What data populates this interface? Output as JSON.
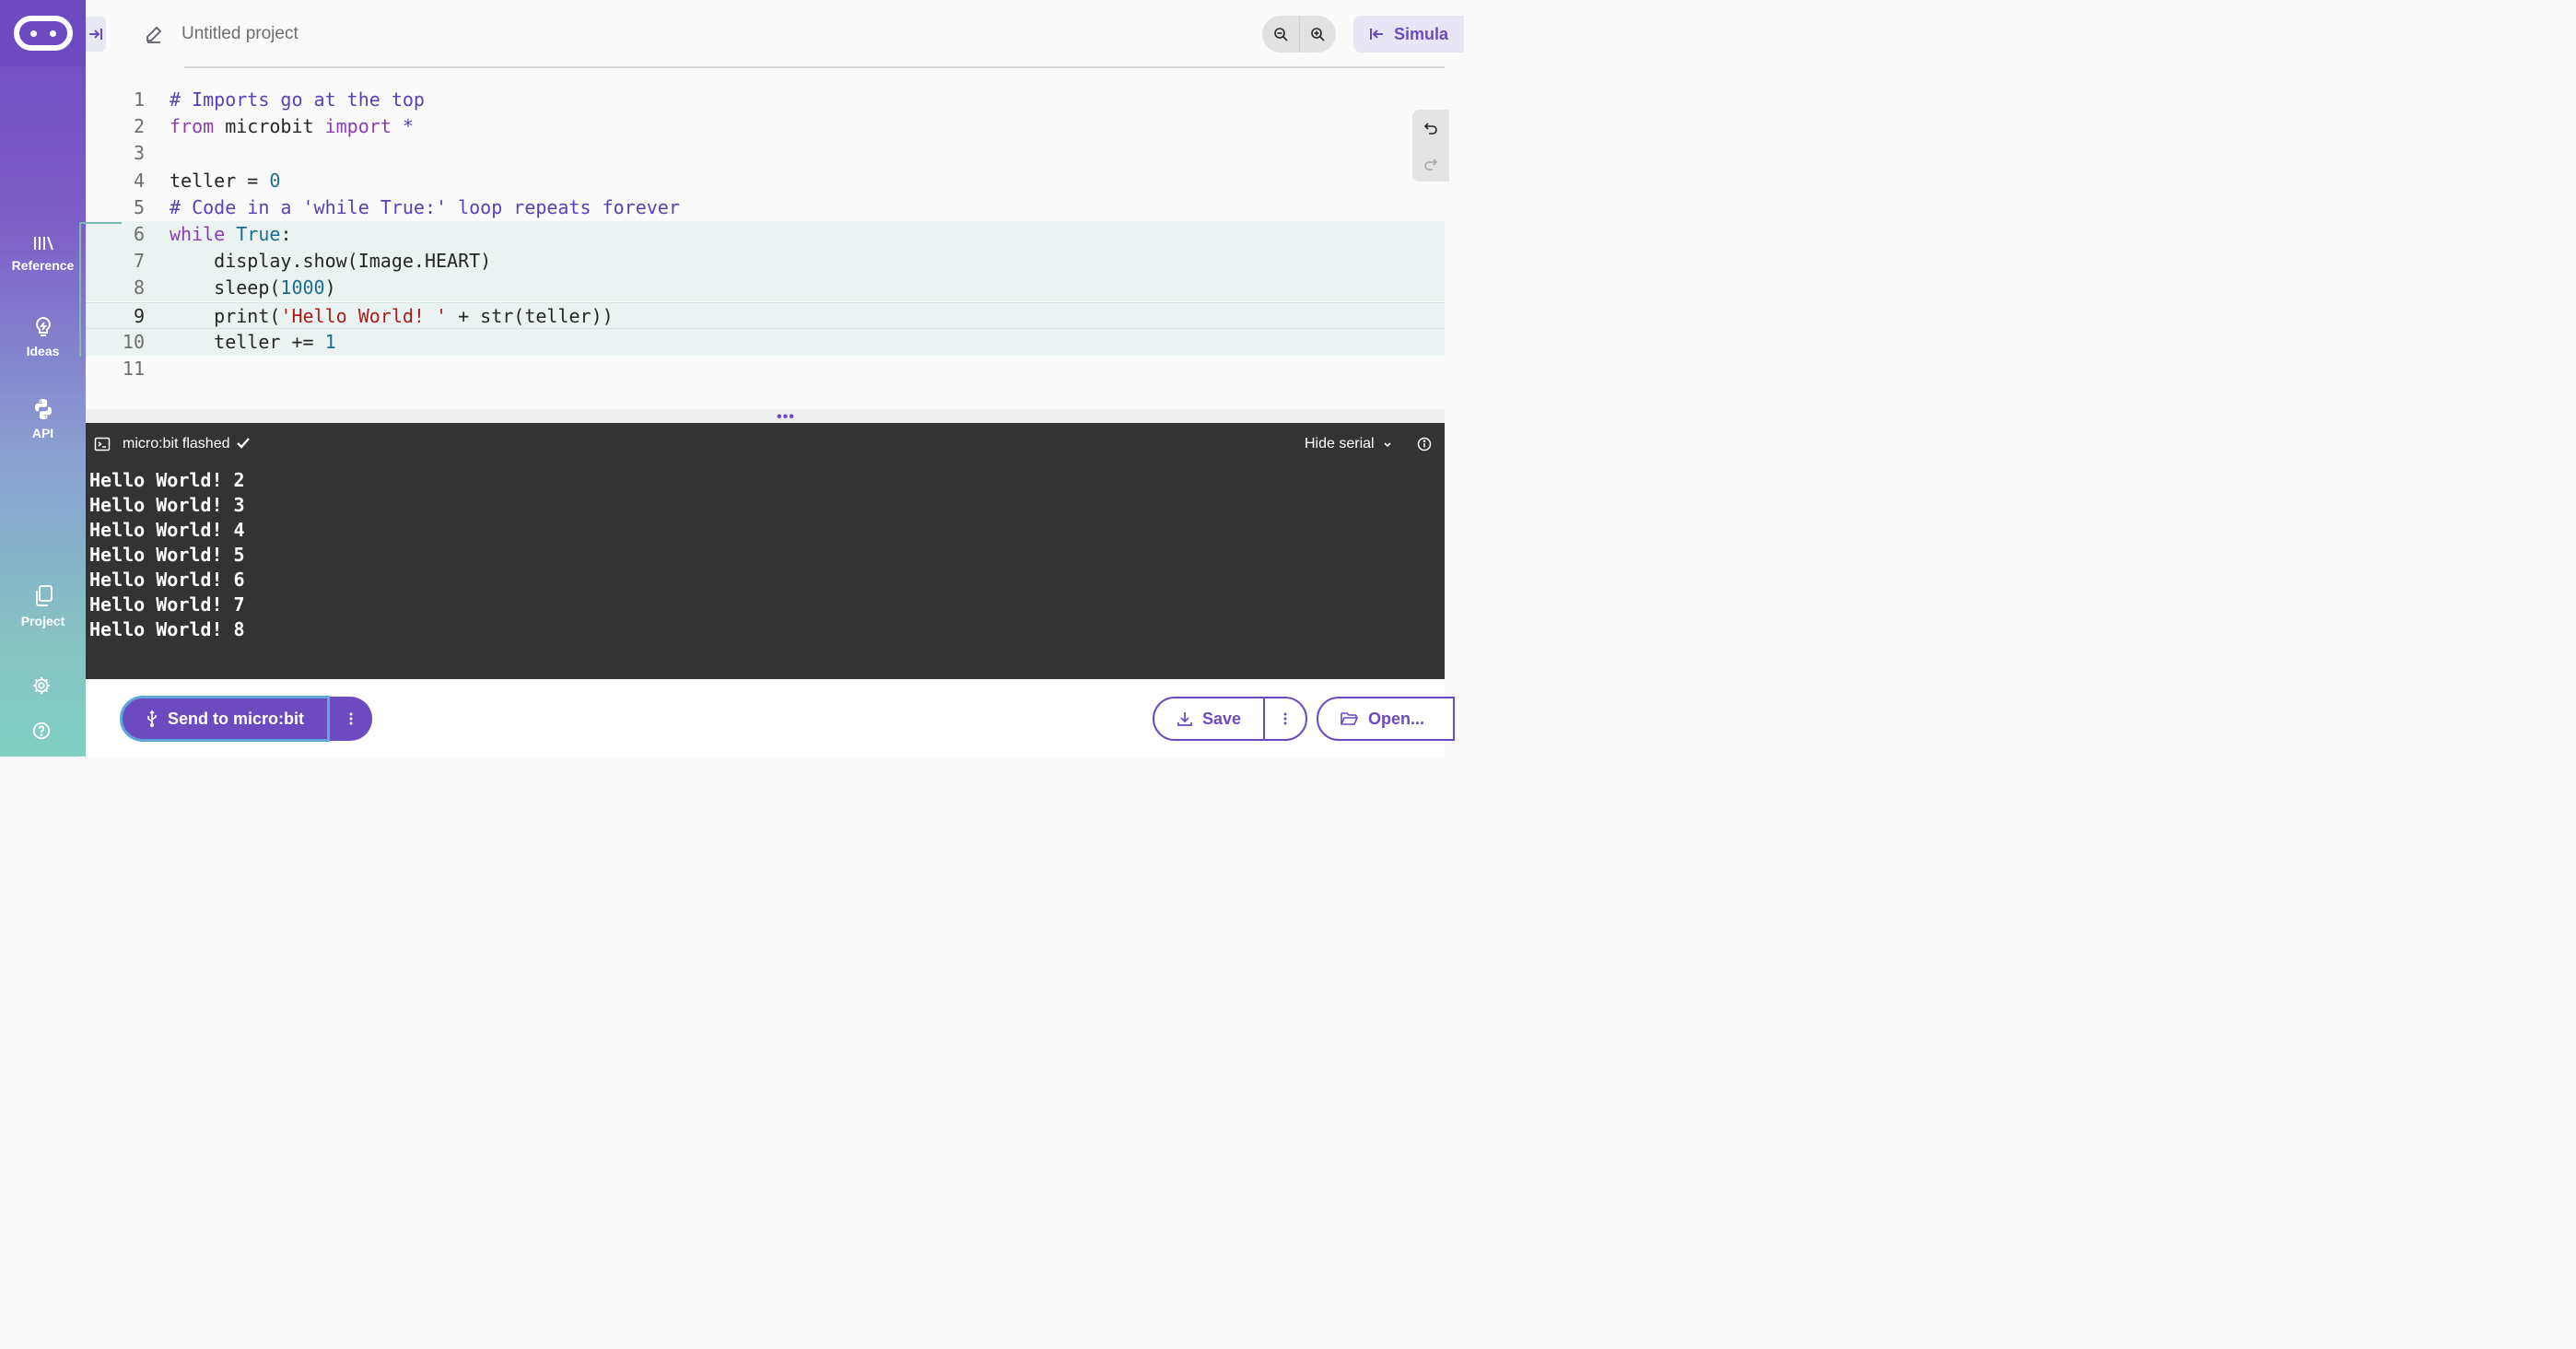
{
  "project": {
    "name": "Untitled project"
  },
  "sidebar": {
    "items": [
      {
        "label": "Reference",
        "icon": "books-icon"
      },
      {
        "label": "Ideas",
        "icon": "lightbulb-icon"
      },
      {
        "label": "API",
        "icon": "python-icon"
      },
      {
        "label": "Project",
        "icon": "files-icon"
      }
    ],
    "settings_icon": "gear-icon",
    "help_icon": "help-icon"
  },
  "toolbar": {
    "simulator_label": "Simula"
  },
  "editor": {
    "current_line": 9,
    "line_numbers": [
      "1",
      "2",
      "3",
      "4",
      "5",
      "6",
      "7",
      "8",
      "9",
      "10",
      "11"
    ],
    "lines": [
      {
        "tokens": [
          {
            "t": "# Imports go at the top",
            "c": "cm"
          }
        ]
      },
      {
        "tokens": [
          {
            "t": "from",
            "c": "kw"
          },
          {
            "t": " microbit ",
            "c": ""
          },
          {
            "t": "import",
            "c": "kw"
          },
          {
            "t": " *",
            "c": "cm"
          }
        ]
      },
      {
        "tokens": []
      },
      {
        "tokens": [
          {
            "t": "teller = ",
            "c": ""
          },
          {
            "t": "0",
            "c": "num"
          }
        ]
      },
      {
        "tokens": [
          {
            "t": "# Code in a 'while True:' loop repeats forever",
            "c": "cm"
          }
        ]
      },
      {
        "tokens": [
          {
            "t": "while",
            "c": "kw"
          },
          {
            "t": " ",
            "c": ""
          },
          {
            "t": "True",
            "c": "num"
          },
          {
            "t": ":",
            "c": ""
          }
        ]
      },
      {
        "tokens": [
          {
            "t": "    display.show(Image.HEART)",
            "c": ""
          }
        ]
      },
      {
        "tokens": [
          {
            "t": "    sleep(",
            "c": ""
          },
          {
            "t": "1000",
            "c": "num"
          },
          {
            "t": ")",
            "c": ""
          }
        ]
      },
      {
        "tokens": [
          {
            "t": "    print(",
            "c": ""
          },
          {
            "t": "'Hello World! '",
            "c": "str"
          },
          {
            "t": " + str(teller))",
            "c": ""
          }
        ]
      },
      {
        "tokens": [
          {
            "t": "    teller += ",
            "c": ""
          },
          {
            "t": "1",
            "c": "num"
          }
        ]
      },
      {
        "tokens": []
      }
    ]
  },
  "serial": {
    "status": "micro:bit flashed",
    "hide_label": "Hide serial",
    "output": [
      "Hello World! 2",
      "Hello World! 3",
      "Hello World! 4",
      "Hello World! 5",
      "Hello World! 6",
      "Hello World! 7",
      "Hello World! 8"
    ]
  },
  "bottom": {
    "send_label": "Send to micro:bit",
    "save_label": "Save",
    "open_label": "Open..."
  },
  "colors": {
    "accent": "#6c4bc1",
    "serial_bg": "#333333",
    "block_bg": "#ebf3f2"
  }
}
